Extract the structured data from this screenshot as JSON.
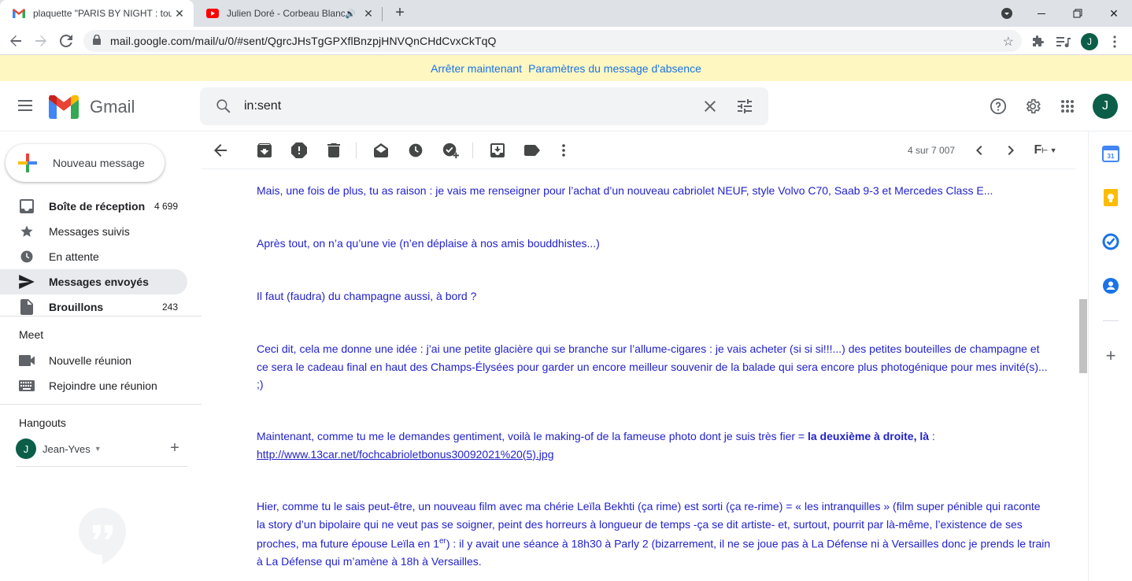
{
  "browser": {
    "tabs": [
      {
        "title": "plaquette \"PARIS BY NIGHT : tour",
        "active": true
      },
      {
        "title": "Julien Doré - Corbeau Blanc",
        "active": false
      }
    ],
    "url": "mail.google.com/mail/u/0/#sent/QgrcJHsTgGPXflBnzpjHNVQnCHdCvxCkTqQ",
    "profile_initial": "J"
  },
  "banner": {
    "stop_label": "Arrêter maintenant",
    "settings_label": "Paramètres du message d'absence"
  },
  "header": {
    "app_name": "Gmail",
    "search_value": "in:sent",
    "avatar_initial": "J"
  },
  "sidebar": {
    "compose_label": "Nouveau message",
    "items": [
      {
        "label": "Boîte de réception",
        "count": "4 699",
        "bold": true,
        "selected": false
      },
      {
        "label": "Messages suivis",
        "count": "",
        "bold": false,
        "selected": false
      },
      {
        "label": "En attente",
        "count": "",
        "bold": false,
        "selected": false
      },
      {
        "label": "Messages envoyés",
        "count": "",
        "bold": true,
        "selected": true
      },
      {
        "label": "Brouillons",
        "count": "243",
        "bold": true,
        "selected": false
      }
    ],
    "meet_title": "Meet",
    "meet_items": [
      "Nouvelle réunion",
      "Rejoindre une réunion"
    ],
    "hangouts_title": "Hangouts",
    "hangouts_user": "Jean-Yves",
    "hangouts_user_initial": "J"
  },
  "toolbar": {
    "pager": "4 sur 7 007",
    "font_label": "F"
  },
  "message": {
    "p1": "Mais, une fois de plus, tu as raison : je vais me renseigner pour l’achat d’un nouveau cabriolet NEUF, style Volvo C70, Saab 9-3 et Mercedes Class E...",
    "p2": "Après tout, on n’a qu’une vie (n’en déplaise à nos amis bouddhistes...)",
    "p3": "Il faut (faudra) du champagne aussi, à bord ?",
    "p4": "Ceci dit, cela me donne une idée : j’ai une petite glacière qui se branche sur l’allume-cigares : je vais acheter (si si si!!!...) des petites bouteilles de champagne et ce sera le cadeau final en haut des Champs-Élysées pour garder un encore meilleur souvenir de la balade qui sera encore plus photogénique pour mes invité(s)... ;)",
    "p5_start": "Maintenant, comme tu me le demandes gentiment, voilà le making-of de la fameuse photo dont je suis très fier = ",
    "p5_bold": "la deuxième à droite, là",
    "p5_end": " :",
    "p5_link": "http://www.13car.net/fochcabrioletbonus30092021%20(5).jpg",
    "p6_start": "Hier, comme tu le sais peut-être, un nouveau film avec ma chérie Leïla Bekhti (ça rime) est sorti (ça re-rime) = « les intranquilles » (film super pénible qui raconte la story d’un bipolaire qui ne veut pas se soigner, peint des horreurs à longueur de temps -ça se dit artiste- et, surtout, pourrit par là-même, l’existence de ses proches, ma future épouse Leïla en 1",
    "p6_sup": "er",
    "p6_end": ") : il y avait une séance à 18h30 à Parly 2 (bizarrement, il ne se joue pas à La Défense ni à Versailles donc je prends le train à La Défense qui m’amène à 18h à Versailles."
  },
  "colors": {
    "message_text": "#2222cc",
    "banner_bg": "#fef7c1",
    "link": "#1a73e8",
    "avatar": "#0b5e47"
  }
}
